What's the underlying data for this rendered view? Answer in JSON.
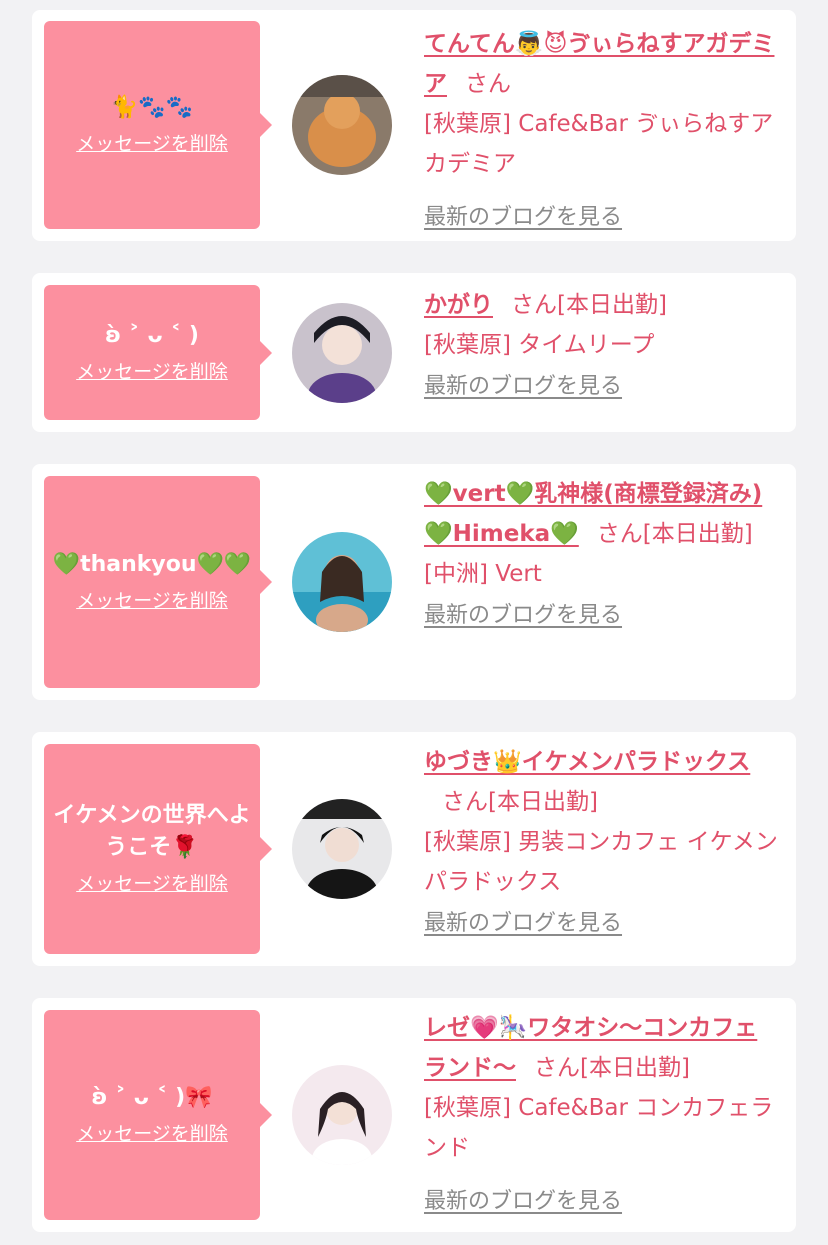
{
  "delete_label": "メッセージを削除",
  "san_label": "さん",
  "blog_label": "最新のブログを見る",
  "colors": {
    "accent": "#e0506a",
    "message_bg": "#fc909f",
    "link_gray": "#8a8a8a"
  },
  "cards": [
    {
      "message": "🐈🐾🐾",
      "name": "てんてん👼😈ゔぃらねすアガデミア",
      "status": "",
      "shop": "[秋葉原] Cafe&Bar ゔぃらねすアカデミア",
      "avatar_icon": "cat-avatar-icon"
    },
    {
      "message": "ʚ̀ ˃ ᴗ ˂ )",
      "name": "かがり",
      "status": "[本日出勤]",
      "shop": "[秋葉原] タイムリープ",
      "avatar_icon": "person-avatar-icon"
    },
    {
      "message": "💚thankyou💚💚",
      "name": "💚vert💚乳神様(商標登録済み)💚Himeka💚",
      "status": "[本日出勤]",
      "shop": "[中洲] Vert",
      "avatar_icon": "person-avatar-icon"
    },
    {
      "message": "イケメンの世界へようこそ🌹",
      "name": "ゆづき👑イケメンパラドックス",
      "status": "[本日出勤]",
      "shop": "[秋葉原] 男装コンカフェ イケメンパラドックス",
      "avatar_icon": "person-avatar-icon"
    },
    {
      "message": "ʚ̀ ˃ ᴗ ˂ )🎀",
      "name": "レゼ💗🎠ワタオシ〜コンカフェランド〜",
      "status": "[本日出勤]",
      "shop": "[秋葉原] Cafe&Bar コンカフェランド",
      "avatar_icon": "person-avatar-icon"
    }
  ]
}
